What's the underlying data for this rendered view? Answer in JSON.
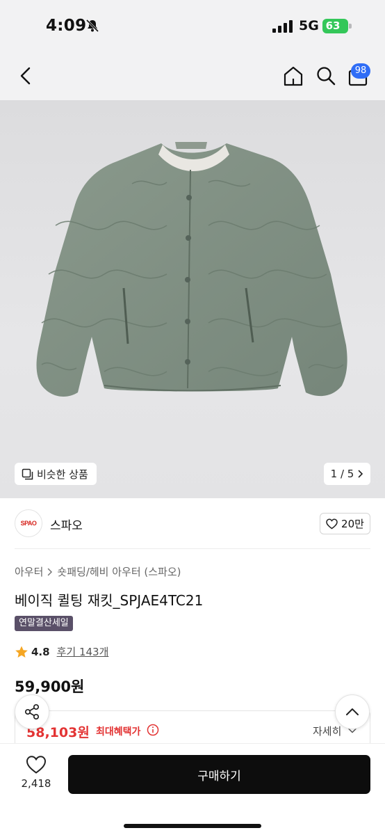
{
  "status_bar": {
    "time": "4:09",
    "network": "5G",
    "battery": "63"
  },
  "nav": {
    "cart_count": "98",
    "icons": [
      "back-icon",
      "home-icon",
      "search-icon",
      "cart-icon"
    ]
  },
  "gallery": {
    "similar_label": "비슷한 상품",
    "counter": "1 / 5"
  },
  "brand": {
    "logo_text": "SPAO",
    "name": "스파오",
    "likes": "20만"
  },
  "breadcrumb": [
    "아우터",
    "숏패딩/헤비 아우터 (스파오)"
  ],
  "product": {
    "title": "베이직 퀼팅 재킷_SPJAE4TC21",
    "tag": "연말결산세일",
    "rating": "4.8",
    "reviews": "후기 143개",
    "price": "59,900원"
  },
  "benefit": {
    "price": "58,103원",
    "label": "최대혜택가",
    "detail": "자세히"
  },
  "bottom": {
    "wish_count": "2,418",
    "buy_label": "구매하기"
  },
  "colors": {
    "accent_red": "#e33333",
    "badge_blue": "#2f6df6",
    "tag_purple": "#5a5068",
    "battery_green": "#34c759",
    "jacket_green": "#7f8f82"
  }
}
